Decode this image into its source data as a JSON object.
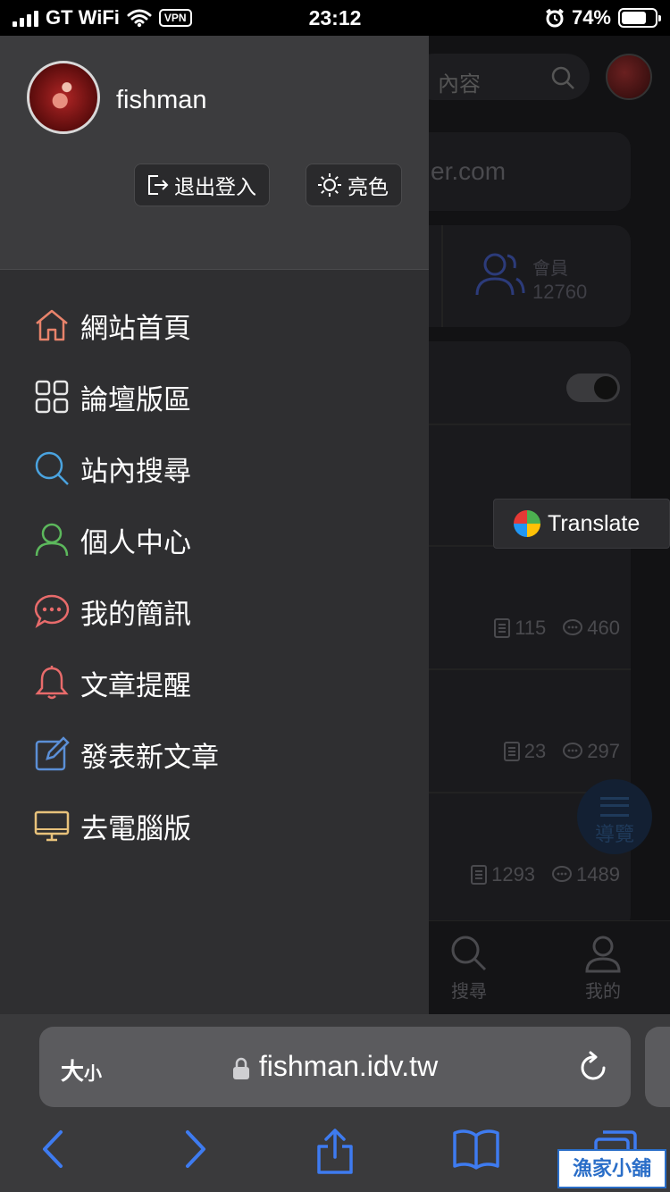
{
  "status_bar": {
    "carrier": "GT WiFi",
    "vpn_label": "VPN",
    "time": "23:12",
    "battery_percent": "74%",
    "battery_level": 0.74
  },
  "drawer": {
    "username": "fishman",
    "logout_label": "退出登入",
    "theme_label": "亮色",
    "menu": [
      {
        "label": "網站首頁",
        "icon": "home-icon",
        "color": "#e8836b"
      },
      {
        "label": "論壇版區",
        "icon": "grid-icon",
        "color": "#e6e6e6"
      },
      {
        "label": "站內搜尋",
        "icon": "search-icon",
        "color": "#4aa3df"
      },
      {
        "label": "個人中心",
        "icon": "user-icon",
        "color": "#5cb85c"
      },
      {
        "label": "我的簡訊",
        "icon": "message-icon",
        "color": "#e86b6b"
      },
      {
        "label": "文章提醒",
        "icon": "bell-icon",
        "color": "#e86b6b"
      },
      {
        "label": "發表新文章",
        "icon": "edit-icon",
        "color": "#5b8fd6"
      },
      {
        "label": "去電腦版",
        "icon": "desktop-icon",
        "color": "#e8c27b"
      }
    ]
  },
  "background_page": {
    "search_placeholder_fragment": "內容",
    "url_fragment": "er.com",
    "members_label": "會員",
    "members_count": "12760",
    "rows": [
      {
        "posts": "115",
        "replies": "460"
      },
      {
        "posts": "23",
        "replies": "297"
      },
      {
        "posts": "1293",
        "replies": "1489"
      }
    ],
    "fab_label": "導覽",
    "tabs": [
      {
        "label": "搜尋",
        "icon": "search-icon"
      },
      {
        "label": "我的",
        "icon": "user-icon"
      }
    ]
  },
  "translate_popup": {
    "label": "Translate"
  },
  "safari": {
    "text_size_big": "大",
    "text_size_small": "小",
    "url": "fishman.idv.tw"
  },
  "watermark": {
    "text": "漁家小舖"
  }
}
